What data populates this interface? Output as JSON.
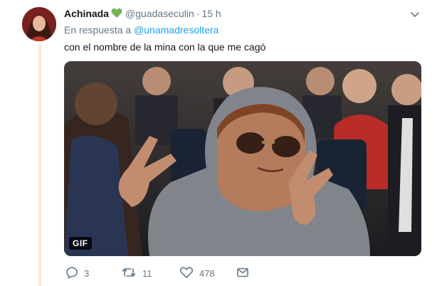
{
  "tweet": {
    "author_name": "Achinada",
    "author_handle": "@guadaseculin",
    "separator": "·",
    "time": "15 h",
    "reply_prefix": "En respuesta a",
    "reply_mention": "@unamadresoltera",
    "text": "con el nombre de la mina con la que me cagó",
    "media_badge": "GIF",
    "replies": "3",
    "retweets": "11",
    "likes": "478"
  },
  "colors": {
    "accent": "#1da1f2",
    "muted": "#657786",
    "heart_emoji": "#77b255",
    "thread_line": "#f7eccf"
  },
  "icons": [
    "heart-emoji-icon",
    "chevron-down-icon",
    "reply-icon",
    "retweet-icon",
    "like-icon",
    "message-icon"
  ]
}
